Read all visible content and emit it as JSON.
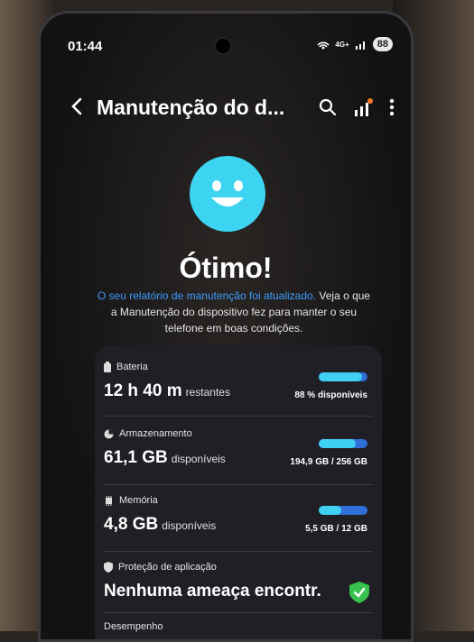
{
  "status": {
    "time": "01:44",
    "battery": "88",
    "network": "4G+"
  },
  "appbar": {
    "title": "Manutenção do d..."
  },
  "result": {
    "heading": "Ótimo!"
  },
  "description": {
    "link": "O seu relatório de manutenção foi atualizado.",
    "rest": " Veja o que a Manutenção do dispositivo fez para manter o seu telefone em boas condições."
  },
  "items": {
    "battery": {
      "label": "Bateria",
      "value": "12 h 40 m",
      "unit": "restantes",
      "detail": "88 % disponíveis",
      "level": 0.88
    },
    "storage": {
      "label": "Armazenamento",
      "value": "61,1 GB",
      "unit": "disponíveis",
      "detail": "194,9 GB / 256 GB",
      "level": 0.76
    },
    "memory": {
      "label": "Memória",
      "value": "4,8 GB",
      "unit": "disponíveis",
      "detail": "5,5 GB / 12 GB",
      "level": 0.46
    },
    "protection": {
      "label": "Proteção de aplicação",
      "value": "Nenhuma ameaça encontr."
    },
    "performance": {
      "label": "Desempenho"
    }
  },
  "colors": {
    "accent": "#3cd4f0",
    "link": "#3d9cff",
    "bar_track": "#2f6fd8",
    "shield": "#37c24f"
  }
}
